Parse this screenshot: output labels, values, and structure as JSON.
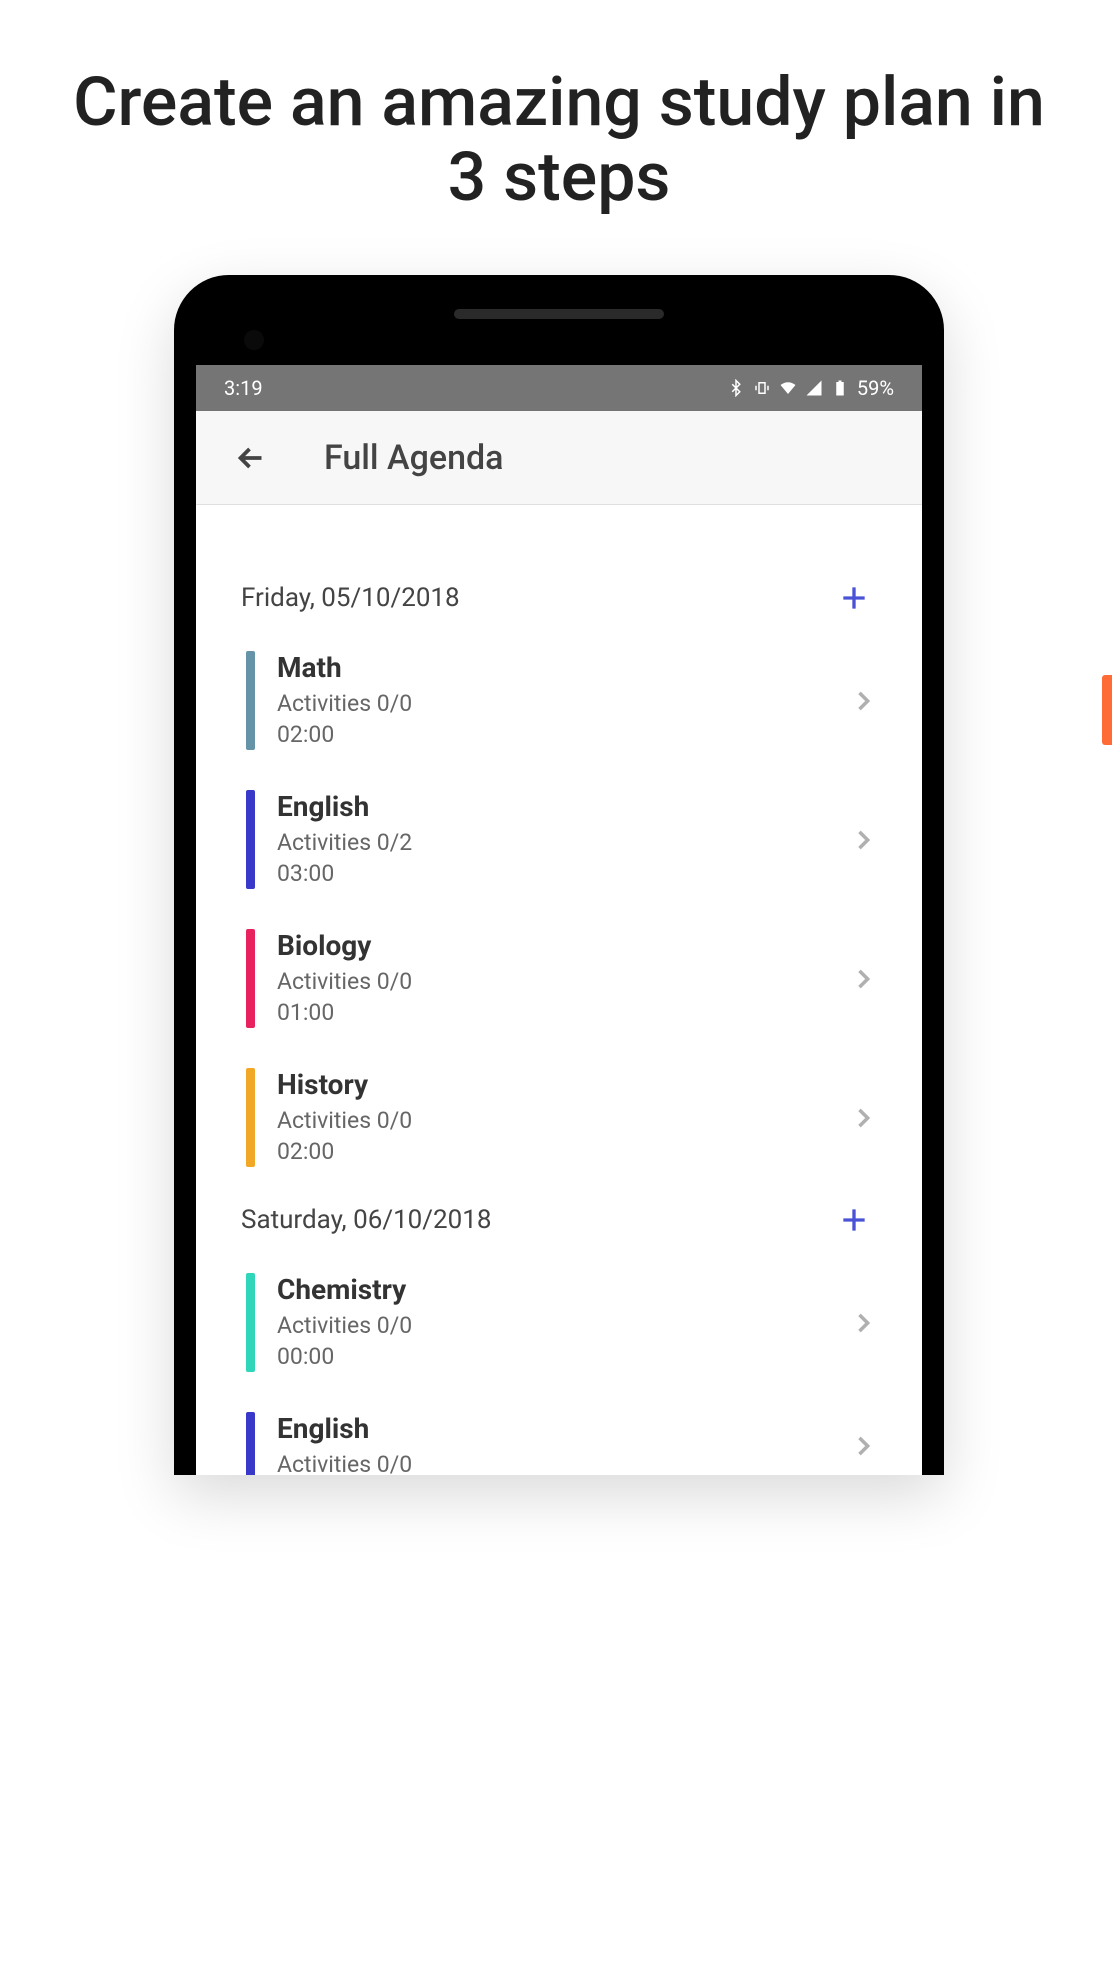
{
  "marketing": {
    "title": "Create an amazing study plan in 3 steps"
  },
  "status": {
    "time": "3:19",
    "battery": "59%"
  },
  "appbar": {
    "title": "Full Agenda"
  },
  "days": [
    {
      "label": "Friday, 05/10/2018",
      "subjects": [
        {
          "name": "Math",
          "activities": "Activities 0/0",
          "duration": "02:00",
          "color": "#6593a8"
        },
        {
          "name": "English",
          "activities": "Activities 0/2",
          "duration": "03:00",
          "color": "#3838c9"
        },
        {
          "name": "Biology",
          "activities": "Activities 0/0",
          "duration": "01:00",
          "color": "#e8225f"
        },
        {
          "name": "History",
          "activities": "Activities 0/0",
          "duration": "02:00",
          "color": "#f0a826"
        }
      ]
    },
    {
      "label": "Saturday, 06/10/2018",
      "subjects": [
        {
          "name": "Chemistry",
          "activities": "Activities 0/0",
          "duration": "00:00",
          "color": "#2fd6b9"
        },
        {
          "name": "English",
          "activities": "Activities 0/0",
          "duration": "",
          "color": "#3838c9"
        }
      ]
    }
  ]
}
